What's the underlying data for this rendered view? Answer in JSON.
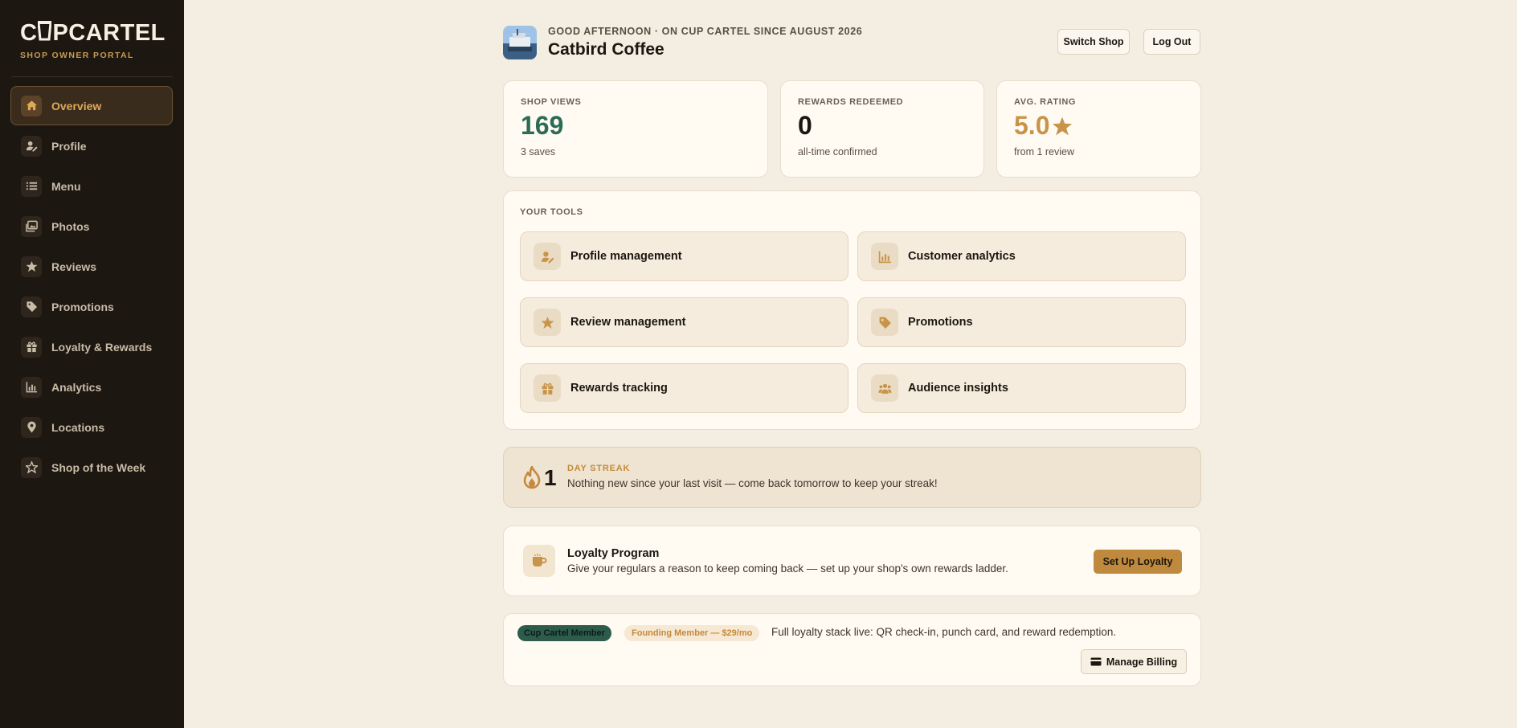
{
  "brand": {
    "logo_pre": "C",
    "logo_post": "PCARTEL",
    "subtitle": "SHOP OWNER PORTAL"
  },
  "sidebar": {
    "items": [
      {
        "label": "Overview",
        "icon": "home-icon",
        "active": true
      },
      {
        "label": "Profile",
        "icon": "user-edit-icon"
      },
      {
        "label": "Menu",
        "icon": "list-icon"
      },
      {
        "label": "Photos",
        "icon": "images-icon"
      },
      {
        "label": "Reviews",
        "icon": "star-icon"
      },
      {
        "label": "Promotions",
        "icon": "tag-icon"
      },
      {
        "label": "Loyalty & Rewards",
        "icon": "gift-icon"
      },
      {
        "label": "Analytics",
        "icon": "chart-icon"
      },
      {
        "label": "Locations",
        "icon": "map-pin-icon"
      },
      {
        "label": "Shop of the Week",
        "icon": "award-star-icon"
      }
    ]
  },
  "header": {
    "greeting": "GOOD AFTERNOON · ON CUP CARTEL SINCE AUGUST 2026",
    "shop_name": "Catbird Coffee",
    "switch_label": "Switch Shop",
    "logout_label": "Log Out"
  },
  "stats": [
    {
      "label": "SHOP VIEWS",
      "value": "169",
      "sub": "3 saves",
      "color": "#2d6b57"
    },
    {
      "label": "REWARDS REDEEMED",
      "value": "0",
      "sub": "all-time confirmed",
      "color": "#1c1610"
    },
    {
      "label": "AVG. RATING",
      "value": "5.0",
      "sub": "from 1 review",
      "color": "#c8944a"
    }
  ],
  "tools": {
    "title": "YOUR TOOLS",
    "items": [
      {
        "label": "Profile management",
        "icon": "user-edit-icon"
      },
      {
        "label": "Customer analytics",
        "icon": "chart-icon"
      },
      {
        "label": "Review management",
        "icon": "star-icon"
      },
      {
        "label": "Promotions",
        "icon": "tag-icon"
      },
      {
        "label": "Rewards tracking",
        "icon": "gift-icon"
      },
      {
        "label": "Audience insights",
        "icon": "users-icon"
      }
    ]
  },
  "streak": {
    "count": "1",
    "title": "DAY STREAK",
    "message": "Nothing new since your last visit — come back tomorrow to keep your streak!"
  },
  "loyalty": {
    "title": "Loyalty Program",
    "text": "Give your regulars a reason to keep coming back — set up your shop's own rewards ladder.",
    "button": "Set Up Loyalty"
  },
  "membership": {
    "badge_member": "Cup Cartel Member",
    "badge_founding": "Founding Member — $29/mo",
    "text": "Full loyalty stack live: QR check-in, punch card, and reward redemption.",
    "billing_button": "Manage Billing"
  },
  "colors": {
    "accent": "#c8944a",
    "sidebar_bg": "#1c1711",
    "page_bg": "#f3ede2",
    "member_green": "#2d5c4d"
  }
}
